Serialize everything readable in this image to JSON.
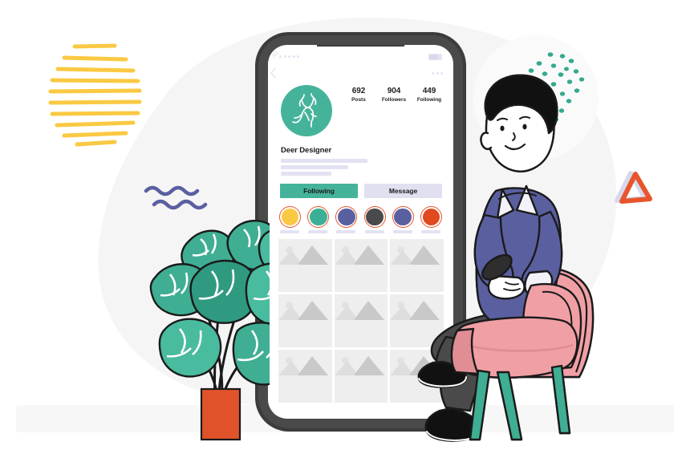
{
  "scene": {
    "title": "Social media profile illustration",
    "background_color": "#ffffff",
    "blob_color": "#f5f5f5"
  },
  "decorations": {
    "sun_stripes": {
      "name": "yellow-striped-circle",
      "color": "#fac943",
      "stripe_count": 10
    },
    "dot_cluster": {
      "name": "teal-dot-cluster",
      "color": "#34a98e",
      "dot_count": 28
    },
    "waves": {
      "name": "purple-wave-lines",
      "color": "#5a5fa0",
      "line_count": 2
    },
    "triangle": {
      "name": "orange-triangle-outline",
      "color": "#e8552c",
      "shadow_color": "#d8d8ec"
    }
  },
  "phone": {
    "frame_color": "#3c3c3c",
    "screen_color": "#ffffff",
    "status_bar": {
      "signal_icon": "signal-dots-icon",
      "wifi_icon": "wifi-icon",
      "battery_icon": "battery-icon"
    },
    "nav": {
      "back_icon": "chevron-left-icon",
      "more_icon": "more-dots-icon"
    }
  },
  "profile": {
    "avatar": {
      "icon": "deer-logo-icon",
      "bg_color": "#45b39a",
      "stroke_color": "#ffffff"
    },
    "username": "Deer Designer",
    "bio_placeholder_lines": 3,
    "stats": [
      {
        "value": "692",
        "label": "Posts"
      },
      {
        "value": "904",
        "label": "Followers"
      },
      {
        "value": "449",
        "label": "Following"
      }
    ],
    "actions": [
      {
        "label": "Following",
        "style": "primary",
        "color": "#45b39a"
      },
      {
        "label": "Message",
        "style": "secondary",
        "color": "#e0e0f0"
      }
    ],
    "highlights": [
      {
        "name": "highlight-1",
        "color": "#fac943",
        "ring_color": "#e8552c"
      },
      {
        "name": "highlight-2",
        "color": "#3cb096",
        "ring_color": "#e8552c"
      },
      {
        "name": "highlight-3",
        "color": "#5a5fa0",
        "ring_color": "#e8552c"
      },
      {
        "name": "highlight-4",
        "color": "#4a4a4a",
        "ring_color": "#e8552c"
      },
      {
        "name": "highlight-5",
        "color": "#5a5fa0",
        "ring_color": "#e8552c"
      },
      {
        "name": "highlight-6",
        "color": "#e04a1e",
        "ring_color": "#e8552c"
      }
    ],
    "grid": {
      "rows": 3,
      "columns": 3,
      "cell_count": 9,
      "placeholder_icon": "image-placeholder-icon",
      "cell_color": "#eeeeee",
      "mountain_color": "#c9c9c9"
    }
  },
  "plant": {
    "name": "monstera-plant",
    "leaf_color": "#3fae93",
    "leaf_color_dark": "#2f9a80",
    "pot_color": "#e0532a",
    "stem_color": "#1a1a1a"
  },
  "person": {
    "name": "man-using-phone",
    "skin_color": "#ffffff",
    "hair_color": "#111111",
    "sweater_color": "#5a5fa0",
    "shirt_color": "#f2f2f8",
    "pants_color": "#4a4a4a",
    "shoe_color": "#111111",
    "phone_color": "#2e2e2e"
  },
  "chair": {
    "name": "pink-armchair",
    "seat_color": "#f0a0a5",
    "seat_shadow": "#e08d93",
    "leg_color": "#3fae93"
  }
}
